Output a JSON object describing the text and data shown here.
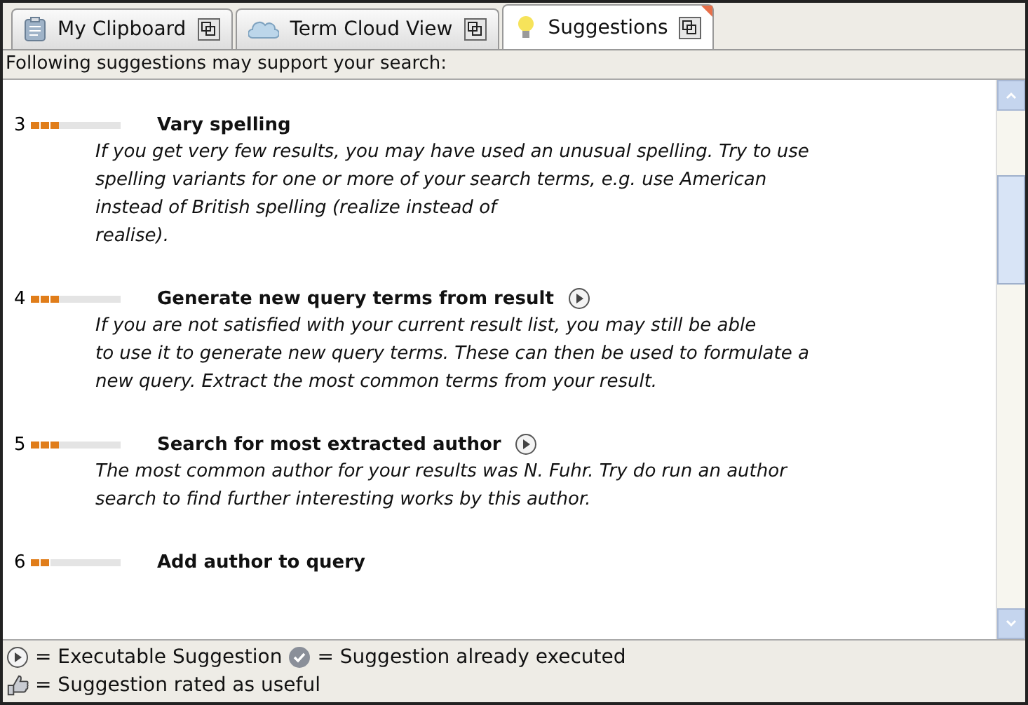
{
  "tabs": [
    {
      "label": "My Clipboard",
      "selected": false
    },
    {
      "label": "Term Cloud View",
      "selected": false
    },
    {
      "label": "Suggestions",
      "selected": true
    }
  ],
  "intro": "Following suggestions may support your search:",
  "suggestions": [
    {
      "number": "3",
      "stars": 3,
      "title": "Vary spelling",
      "executable": false,
      "lines": [
        "If you get very few results, you may have used an unusual spelling. Try to use",
        "spelling variants for one or more of your search terms, e.g. use American",
        "instead of British spelling (realize instead of",
        "realise)."
      ]
    },
    {
      "number": "4",
      "stars": 3,
      "title": "Generate new query terms from result",
      "executable": true,
      "lines": [
        "If you are not satisfied with your current result list, you may still be able",
        "to use it to generate new query terms. These can then be used to formulate a",
        "new query. Extract the most common terms from your result."
      ]
    },
    {
      "number": "5",
      "stars": 3,
      "title": "Search for most extracted author",
      "executable": true,
      "lines": [
        "The most common author for your results was N. Fuhr. Try do run an author",
        "search to find further interesting works by this author."
      ]
    },
    {
      "number": "6",
      "stars": 2,
      "title": "Add author to query",
      "executable": false
    }
  ],
  "legend": {
    "executable": "= Executable Suggestion",
    "executed": "= Suggestion already executed",
    "useful": "= Suggestion rated as useful"
  }
}
